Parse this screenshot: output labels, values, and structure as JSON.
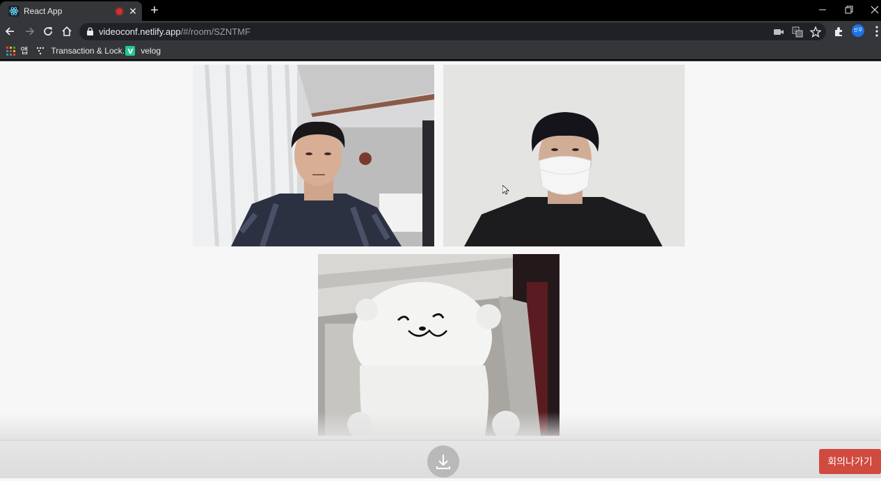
{
  "browser": {
    "tab_title": "React App",
    "url_host": "videoconf.netlify.app",
    "url_path": "/#/room/SZNTMF",
    "profile_label": "신우",
    "bookmarks": [
      {
        "label": "앱",
        "icon": "apps-grid-icon"
      },
      {
        "label": "Transaction & Lock...",
        "icon": "dots-favicon-icon"
      },
      {
        "label": "velog",
        "icon": "velog-favicon-icon"
      }
    ],
    "colors": {
      "tab_bg": "#35363a",
      "recording": "#d93025",
      "profile": "#1a73e8"
    }
  },
  "conference": {
    "participants": [
      {
        "id": "participant-1",
        "content": "man-in-room-video"
      },
      {
        "id": "participant-2",
        "content": "masked-person-video"
      },
      {
        "id": "participant-3",
        "content": "white-seal-plush-video"
      }
    ],
    "leave_label": "회의나가기",
    "download_icon": "download-icon",
    "leave_color": "#d04a40"
  }
}
